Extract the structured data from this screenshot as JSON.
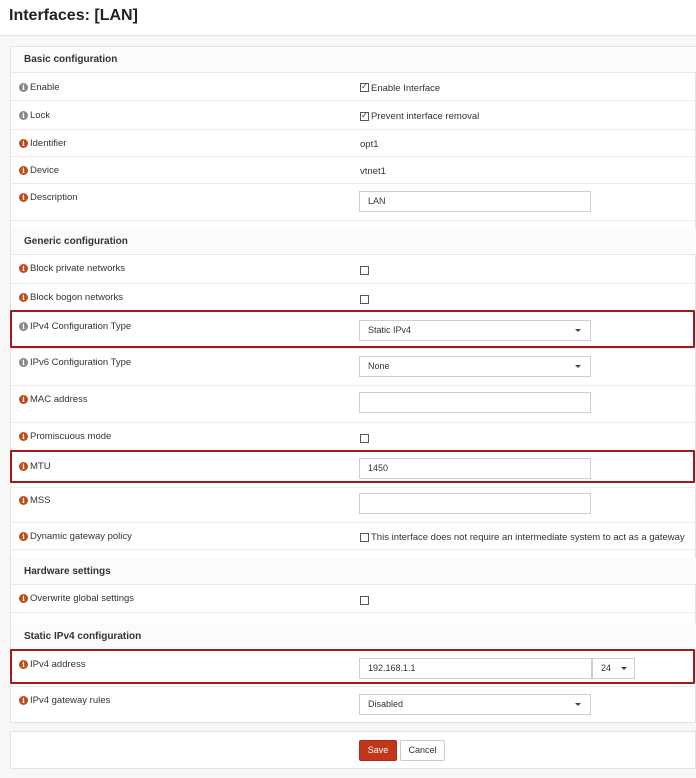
{
  "page": {
    "title": "Interfaces: [LAN]"
  },
  "sections": {
    "basic": "Basic configuration",
    "generic": "Generic configuration",
    "hardware": "Hardware settings",
    "static_ipv4": "Static IPv4 configuration"
  },
  "basic": {
    "enable_label": "Enable",
    "enable_text": "Enable Interface",
    "lock_label": "Lock",
    "lock_text": "Prevent interface removal",
    "identifier_label": "Identifier",
    "identifier_value": "opt1",
    "device_label": "Device",
    "device_value": "vtnet1",
    "description_label": "Description",
    "description_value": "LAN"
  },
  "generic": {
    "block_private_label": "Block private networks",
    "block_bogon_label": "Block bogon networks",
    "ipv4_type_label": "IPv4 Configuration Type",
    "ipv4_type_value": "Static IPv4",
    "ipv6_type_label": "IPv6 Configuration Type",
    "ipv6_type_value": "None",
    "mac_label": "MAC address",
    "mac_value": "",
    "promisc_label": "Promiscuous mode",
    "mtu_label": "MTU",
    "mtu_value": "1450",
    "mss_label": "MSS",
    "mss_value": "",
    "dyn_gw_label": "Dynamic gateway policy",
    "dyn_gw_text": "This interface does not require an intermediate system to act as a gateway"
  },
  "hardware": {
    "overwrite_label": "Overwrite global settings"
  },
  "static_ipv4": {
    "address_label": "IPv4 address",
    "address_value": "192.168.1.1",
    "prefix_value": "24",
    "gw_rules_label": "IPv4 gateway rules",
    "gw_rules_value": "Disabled"
  },
  "actions": {
    "save": "Save",
    "cancel": "Cancel"
  },
  "colors": {
    "accent": "#c0371b",
    "highlight": "#a11a1a",
    "info_red": "#c24a19",
    "info_grey": "#888888"
  }
}
